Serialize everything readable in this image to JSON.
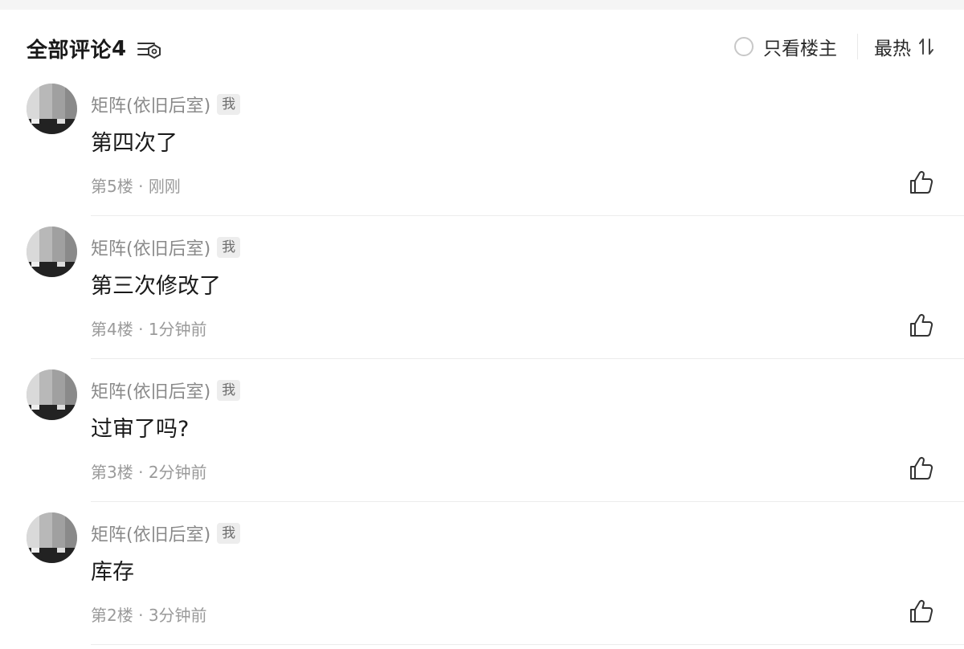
{
  "header": {
    "title": "全部评论",
    "count": "4",
    "filter_icon": "filter-sort-icon",
    "op_only_label": "只看楼主",
    "sort_label": "最热",
    "sort_icon": "sort-arrows-icon"
  },
  "comments": [
    {
      "author": "矩阵(依旧后室)",
      "badge": "我",
      "text": "第四次了",
      "floor": "第5楼",
      "time": "刚刚",
      "like_icon": "thumbs-up-icon"
    },
    {
      "author": "矩阵(依旧后室)",
      "badge": "我",
      "text": "第三次修改了",
      "floor": "第4楼",
      "time": "1分钟前",
      "like_icon": "thumbs-up-icon"
    },
    {
      "author": "矩阵(依旧后室)",
      "badge": "我",
      "text": "过审了吗?",
      "floor": "第3楼",
      "time": "2分钟前",
      "like_icon": "thumbs-up-icon"
    },
    {
      "author": "矩阵(依旧后室)",
      "badge": "我",
      "text": "库存",
      "floor": "第2楼",
      "time": "3分钟前",
      "like_icon": "thumbs-up-icon"
    }
  ],
  "colors": {
    "text_primary": "#1a1a1a",
    "text_secondary": "#8a8a8a",
    "badge_bg": "#ededed",
    "divider": "#ececec"
  }
}
